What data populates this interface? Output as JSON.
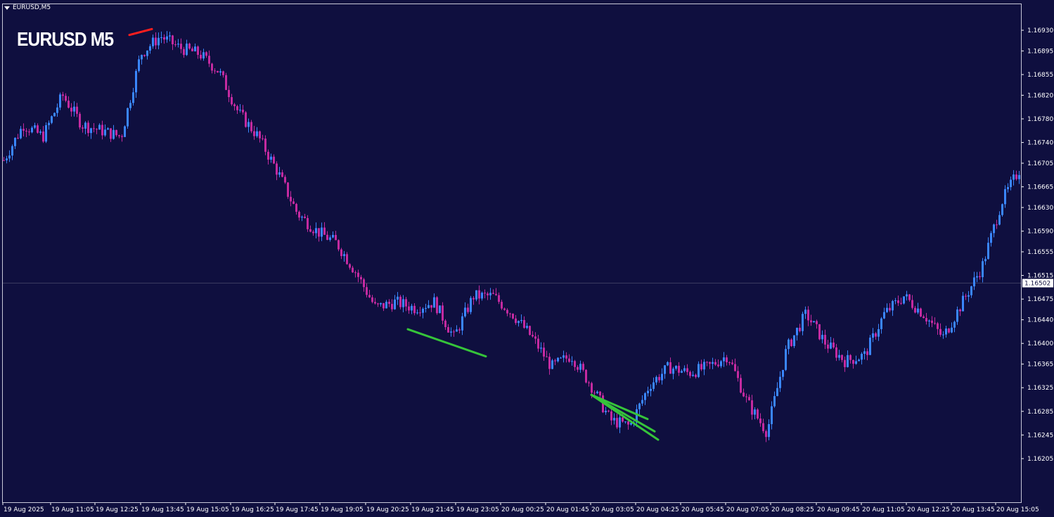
{
  "window": {
    "title": "EURUSD,M5",
    "label": "EURUSD M5"
  },
  "colors": {
    "background": "#0f0f3f",
    "bull": "#3a86ff",
    "bear": "#c42aa0",
    "trend_up": "#36c43a",
    "trend_down": "#ff1e1e",
    "grid_line": "#3a3a60",
    "text": "#ffffff"
  },
  "chart_data": {
    "type": "line",
    "symbol": "EURUSD",
    "timeframe": "M5",
    "current_price": "1.16502",
    "ylim": [
      1.1619,
      1.1695
    ],
    "y_ticks": [
      "1.16930",
      "1.16895",
      "1.16855",
      "1.16820",
      "1.16780",
      "1.16740",
      "1.16705",
      "1.16665",
      "1.16630",
      "1.16590",
      "1.16555",
      "1.16515",
      "1.16475",
      "1.16440",
      "1.16400",
      "1.16365",
      "1.16325",
      "1.16285",
      "1.16245",
      "1.16205"
    ],
    "x_ticks": [
      "19 Aug 2025",
      "19 Aug 11:05",
      "19 Aug 12:25",
      "19 Aug 13:45",
      "19 Aug 15:05",
      "19 Aug 16:25",
      "19 Aug 17:45",
      "19 Aug 19:05",
      "19 Aug 20:25",
      "19 Aug 21:45",
      "19 Aug 23:05",
      "20 Aug 00:25",
      "20 Aug 01:45",
      "20 Aug 03:05",
      "20 Aug 04:25",
      "20 Aug 05:45",
      "20 Aug 07:05",
      "20 Aug 08:25",
      "20 Aug 09:45",
      "20 Aug 11:05",
      "20 Aug 12:25",
      "20 Aug 13:45",
      "20 Aug 15:05"
    ],
    "x_key": [
      0,
      68,
      131,
      196,
      260,
      324,
      387,
      451,
      516,
      580,
      644,
      708,
      772,
      836,
      900,
      964,
      1028,
      1092,
      1157,
      1221,
      1285,
      1349,
      1412
    ],
    "y_key": [
      1.1671,
      1.1677,
      1.1675,
      1.1682,
      1.1677,
      1.1676,
      1.1675,
      1.1689,
      1.1692,
      1.169,
      1.1689,
      1.1686,
      1.1679,
      1.1675,
      1.1669,
      1.1662,
      1.1659,
      1.1657,
      1.1652,
      1.1646,
      1.1647,
      1.1646,
      1.1647,
      1.1641,
      1.1648,
      1.1648,
      1.1645,
      1.1641,
      1.1636,
      1.1638,
      1.1633,
      1.1627,
      1.1626,
      1.1633,
      1.1636,
      1.1635,
      1.1636,
      1.1638,
      1.163,
      1.1625,
      1.1639,
      1.1645,
      1.164,
      1.1637,
      1.1638,
      1.1645,
      1.1648,
      1.1645,
      1.1641,
      1.1647,
      1.1653,
      1.1664,
      1.167
    ],
    "series": [
      {
        "name": "",
        "segments": [
          {
            "from": [
              576,
              1.16424
            ],
            "to": [
              687,
              1.16378
            ],
            "color": "trend_up"
          },
          {
            "from": [
              837,
              1.16313
            ],
            "to": [
              917,
              1.16272
            ],
            "color": "trend_up"
          },
          {
            "from": [
              837,
              1.16313
            ],
            "to": [
              927,
              1.16251
            ],
            "color": "trend_up"
          },
          {
            "from": [
              837,
              1.16313
            ],
            "to": [
              932,
              1.16237
            ],
            "color": "trend_up"
          },
          {
            "from": [
              180,
              1.16922
            ],
            "to": [
              212,
              1.16932
            ],
            "color": "trend_down"
          }
        ]
      }
    ]
  }
}
